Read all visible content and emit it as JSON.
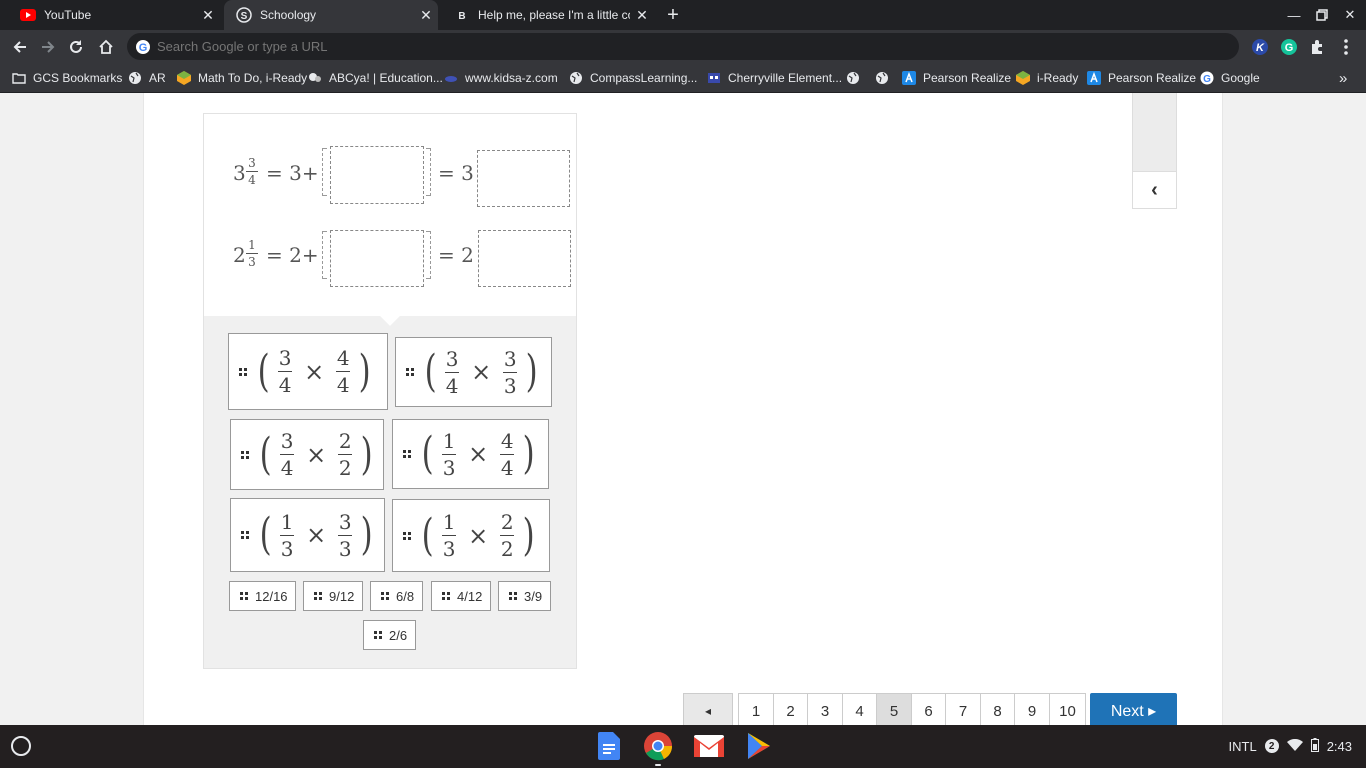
{
  "browser": {
    "tabs": [
      {
        "title": "YouTube",
        "favicon": "youtube-icon",
        "active": false
      },
      {
        "title": "Schoology",
        "favicon": "schoology-icon",
        "active": true
      },
      {
        "title": "Help me, please I'm a little confu",
        "favicon": "brainly-icon",
        "active": false
      }
    ],
    "omnibox_placeholder": "Search Google or type a URL",
    "bookmarks": [
      {
        "label": "GCS Bookmarks",
        "icon": "folder-icon"
      },
      {
        "label": "AR",
        "icon": "globe-icon"
      },
      {
        "label": "Math To Do, i-Ready",
        "icon": "iready-icon"
      },
      {
        "label": "ABCya! | Education...",
        "icon": "abcya-icon"
      },
      {
        "label": "www.kidsa-z.com",
        "icon": "kidsaz-icon"
      },
      {
        "label": "CompassLearning...",
        "icon": "globe-icon"
      },
      {
        "label": "Cherryville Element...",
        "icon": "school-icon"
      },
      {
        "label": "",
        "icon": "globe-icon"
      },
      {
        "label": "",
        "icon": "globe-icon"
      },
      {
        "label": "Pearson Realize",
        "icon": "pearson-icon"
      },
      {
        "label": "i-Ready",
        "icon": "iready-icon"
      },
      {
        "label": "Pearson Realize",
        "icon": "pearson-icon"
      },
      {
        "label": "Google",
        "icon": "google-icon"
      }
    ],
    "overflow": "»"
  },
  "question": {
    "row1": {
      "whole": "3",
      "num": "3",
      "den": "4",
      "eq": "= 3+",
      "eq2": "= 3"
    },
    "row2": {
      "whole": "2",
      "num": "1",
      "den": "3",
      "eq": "= 2+",
      "eq2": "= 2"
    },
    "expression_tiles": [
      {
        "a_num": "3",
        "a_den": "4",
        "b_num": "4",
        "b_den": "4"
      },
      {
        "a_num": "3",
        "a_den": "4",
        "b_num": "3",
        "b_den": "3"
      },
      {
        "a_num": "3",
        "a_den": "4",
        "b_num": "2",
        "b_den": "2"
      },
      {
        "a_num": "1",
        "a_den": "3",
        "b_num": "4",
        "b_den": "4"
      },
      {
        "a_num": "1",
        "a_den": "3",
        "b_num": "3",
        "b_den": "3"
      },
      {
        "a_num": "1",
        "a_den": "3",
        "b_num": "2",
        "b_den": "2"
      }
    ],
    "times_symbol": "×",
    "open_paren": "(",
    "close_paren": ")",
    "answer_chips": [
      "12/16",
      "9/12",
      "6/8",
      "4/12",
      "3/9",
      "2/6"
    ]
  },
  "side_toggle": "‹",
  "pager": {
    "prev": "◂",
    "pages": [
      "1",
      "2",
      "3",
      "4",
      "5",
      "6",
      "7",
      "8",
      "9",
      "10"
    ],
    "current": "5",
    "next_label": "Next ▸"
  },
  "shelf": {
    "apps": [
      "docs-icon",
      "chrome-icon",
      "gmail-icon",
      "play-store-icon"
    ],
    "ime": "INTL",
    "notifications": "2",
    "time": "2:43"
  },
  "colors": {
    "next_button": "#1f73b7",
    "tab_bg": "#35363a",
    "titlebar": "#202124"
  }
}
